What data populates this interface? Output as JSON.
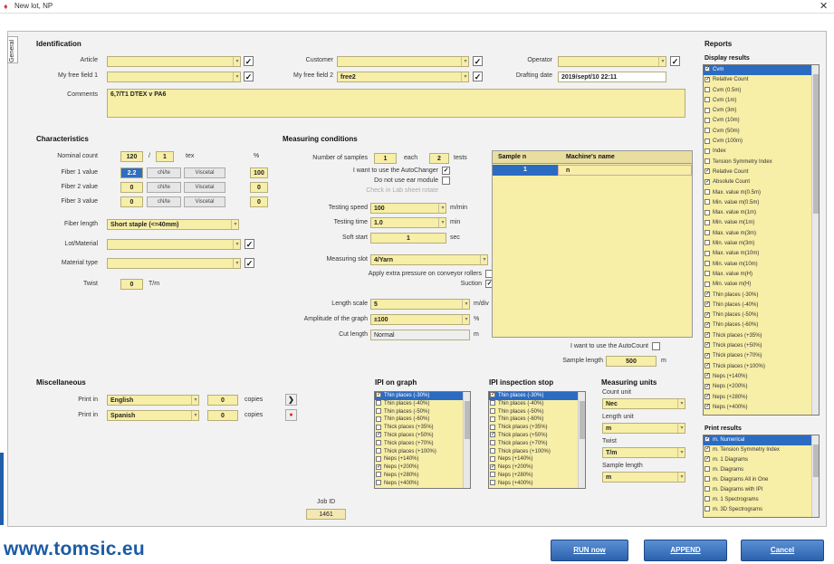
{
  "window": {
    "title": "New lot, NP",
    "close_glyph": "✕"
  },
  "tab": {
    "label": "General"
  },
  "identification": {
    "title": "Identification",
    "article_label": "Article",
    "article_value": "",
    "free1_label": "My free field 1",
    "free1_value": "",
    "customer_label": "Customer",
    "customer_value": "",
    "free2_label": "My free field 2",
    "free2_value": "free2",
    "operator_label": "Operator",
    "operator_value": "",
    "date_label": "Drafting date",
    "date_value": "2019/sept/10 22:11",
    "comments_label": "Comments",
    "comments_value": "6,7/T1 DTEX v PA6"
  },
  "characteristics": {
    "title": "Characteristics",
    "nominal_label": "Nominal count",
    "nominal_value": "120",
    "nominal_sep": "/",
    "nominal_ply": "1",
    "nominal_unit": "tex",
    "pct_header": "%",
    "fibers": [
      {
        "label": "Fiber 1 value",
        "value": "2.2",
        "unit": "cN/te",
        "btn": "Viscetal",
        "pct": "100"
      },
      {
        "label": "Fiber 2 value",
        "value": "0",
        "unit": "cN/te",
        "btn": "Viscetal",
        "pct": "0"
      },
      {
        "label": "Fiber 3 value",
        "value": "0",
        "unit": "cN/te",
        "btn": "Viscetal",
        "pct": "0"
      }
    ],
    "length_label": "Fiber length",
    "length_value": "Short staple (<=40mm)",
    "lot_label": "Lot/Material",
    "lot_value": "",
    "mattype_label": "Material type",
    "mattype_value": "",
    "twist_label": "Twist",
    "twist_value": "0",
    "twist_unit": "T/m"
  },
  "measuring": {
    "title": "Measuring conditions",
    "samples_label": "Number of samples",
    "samples_value": "1",
    "each_label": "each",
    "tests_value": "2",
    "tests_unit": "tests",
    "autochanger_label": "I want to use the AutoChanger",
    "autochanger_checked": "✓",
    "donotuse_label": "Do not use ear module",
    "donotuse_checked": "",
    "disabled_label": "Check in Lab sheet rotate",
    "speed_label": "Testing speed",
    "speed_value": "100",
    "speed_unit": "m/min",
    "time_label": "Testing time",
    "time_value": "1.0",
    "time_unit": "min",
    "softstart_label": "Soft start",
    "softstart_value": "1",
    "softstart_unit": "sec",
    "slot_label": "Measuring slot",
    "slot_value": "4/Yarn",
    "pressure_label": "Apply extra pressure on conveyor rollers",
    "pressure_checked": "",
    "suction_label": "Suction",
    "suction_checked": "✓",
    "lengthscale_label": "Length scale",
    "lengthscale_value": "5",
    "lengthscale_unit": "m/div",
    "amplitude_label": "Amplitude of the graph",
    "amplitude_value": "±100",
    "amplitude_unit": "%",
    "cutlength_label": "Cut length",
    "cutlength_value": "Normal",
    "cutlength_unit": "m"
  },
  "sample_table": {
    "headers": [
      "Sample n",
      "Machine's name"
    ],
    "rows": [
      {
        "n": "1",
        "name": "n"
      }
    ]
  },
  "autocount": {
    "label": "I want to use the AutoCount",
    "checked": "",
    "length_label": "Sample length",
    "length_value": "500",
    "length_unit": "m"
  },
  "misc": {
    "title": "Miscellaneous",
    "rows": [
      {
        "label": "Print in",
        "value": "English",
        "copies": "0",
        "copies_label": "copies",
        "icon": "❯"
      },
      {
        "label": "Print in",
        "value": "Spanish",
        "copies": "0",
        "copies_label": "copies",
        "icon": "●"
      }
    ],
    "jobid_label": "Job ID",
    "jobid_value": "1461"
  },
  "ipi_graph": {
    "title": "IPI on graph"
  },
  "ipi_stop": {
    "title": "IPI inspection stop"
  },
  "ipi_items": [
    {
      "label": "Thin places (-30%)",
      "checked": "✓",
      "sel": true
    },
    {
      "label": "Thin places (-40%)",
      "checked": ""
    },
    {
      "label": "Thin places (-50%)",
      "checked": ""
    },
    {
      "label": "Thin places (-60%)",
      "checked": ""
    },
    {
      "label": "Thick places (+35%)",
      "checked": ""
    },
    {
      "label": "Thick places (+50%)",
      "checked": "✓"
    },
    {
      "label": "Thick places (+70%)",
      "checked": ""
    },
    {
      "label": "Thick places (+100%)",
      "checked": ""
    },
    {
      "label": "Neps (+140%)",
      "checked": ""
    },
    {
      "label": "Neps (+200%)",
      "checked": "✓"
    },
    {
      "label": "Neps (+280%)",
      "checked": ""
    },
    {
      "label": "Neps (+400%)",
      "checked": ""
    }
  ],
  "units": {
    "title": "Measuring units",
    "count_label": "Count unit",
    "count_value": "Nec",
    "length_label": "Length unit",
    "length_value": "m",
    "twist_label": "Twist",
    "twist_value": "T/m",
    "sample_label": "Sample length",
    "sample_value": "m"
  },
  "reports": {
    "title": "Reports",
    "display_title": "Display results",
    "display_items": [
      {
        "label": "Cvm",
        "checked": "✓",
        "sel": true
      },
      {
        "label": "Relative Count",
        "checked": "✓"
      },
      {
        "label": "Cvm (0.5m)",
        "checked": ""
      },
      {
        "label": "Cvm (1m)",
        "checked": ""
      },
      {
        "label": "Cvm (3m)",
        "checked": ""
      },
      {
        "label": "Cvm (10m)",
        "checked": ""
      },
      {
        "label": "Cvm (50m)",
        "checked": ""
      },
      {
        "label": "Cvm (100m)",
        "checked": ""
      },
      {
        "label": "Index",
        "checked": ""
      },
      {
        "label": "Tension Symmetry Index",
        "checked": ""
      },
      {
        "label": "Relative Count",
        "checked": "✓"
      },
      {
        "label": "Absolute Count",
        "checked": "✓"
      },
      {
        "label": "Max. value m(0.5m)",
        "checked": ""
      },
      {
        "label": "Min. value m(0.5m)",
        "checked": ""
      },
      {
        "label": "Max. value m(1m)",
        "checked": ""
      },
      {
        "label": "Min. value m(1m)",
        "checked": ""
      },
      {
        "label": "Max. value m(3m)",
        "checked": ""
      },
      {
        "label": "Min. value m(3m)",
        "checked": ""
      },
      {
        "label": "Max. value m(10m)",
        "checked": ""
      },
      {
        "label": "Min. value m(10m)",
        "checked": ""
      },
      {
        "label": "Max. value m(H)",
        "checked": ""
      },
      {
        "label": "Min. value m(H)",
        "checked": ""
      },
      {
        "label": "Thin places (-30%)",
        "checked": "✓"
      },
      {
        "label": "Thin places (-40%)",
        "checked": "✓"
      },
      {
        "label": "Thin places (-50%)",
        "checked": "✓"
      },
      {
        "label": "Thin places (-60%)",
        "checked": "✓"
      },
      {
        "label": "Thick places (+35%)",
        "checked": "✓"
      },
      {
        "label": "Thick places (+50%)",
        "checked": "✓"
      },
      {
        "label": "Thick places (+70%)",
        "checked": "✓"
      },
      {
        "label": "Thick places (+100%)",
        "checked": "✓"
      },
      {
        "label": "Neps (+140%)",
        "checked": "✓"
      },
      {
        "label": "Neps (+200%)",
        "checked": "✓"
      },
      {
        "label": "Neps (+280%)",
        "checked": "✓"
      },
      {
        "label": "Neps (+400%)",
        "checked": "✓"
      }
    ],
    "print_title": "Print results",
    "print_items": [
      {
        "label": "m. Numerical",
        "checked": "✓",
        "sel": true
      },
      {
        "label": "m. Tension Symmetry Index",
        "checked": "✓"
      },
      {
        "label": "m. 1 Diagrams",
        "checked": "✓"
      },
      {
        "label": "m. Diagrams",
        "checked": ""
      },
      {
        "label": "m. Diagrams All in One",
        "checked": ""
      },
      {
        "label": "m. Diagrams with IPI",
        "checked": ""
      },
      {
        "label": "m. 1 Spectrograms",
        "checked": ""
      },
      {
        "label": "m. 3D Spectrograms",
        "checked": ""
      }
    ]
  },
  "buttons": {
    "run": "RUN now",
    "append": "APPEND",
    "cancel": "Cancel"
  },
  "brand": "www.tomsic.eu",
  "colors": {
    "field": "#f7eea7",
    "accent": "#2c6bc2",
    "brand": "#1c5aa5"
  }
}
